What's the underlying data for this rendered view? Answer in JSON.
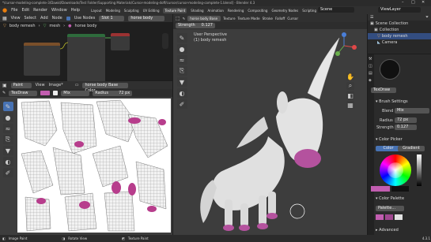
{
  "window": {
    "title": "*/cursor-modeling-complete-3/Dawid/Downloads/Test Folder/Supporting Materials/Cursor-modeling-doff/cursor/cursor-modeling-complete-1.blend] - Blender 4.3"
  },
  "menubar": {
    "items": [
      "File",
      "Edit",
      "Render",
      "Window",
      "Help"
    ],
    "workspaces": [
      "Layout",
      "Modeling",
      "Sculpting",
      "UV Editing",
      "Texture Paint",
      "Shading",
      "Animation",
      "Rendering",
      "Compositing",
      "Geometry Nodes",
      "Scripting"
    ],
    "active_workspace": "Texture Paint",
    "scene": "Scene",
    "view_layer": "ViewLayer"
  },
  "node_editor": {
    "header": [
      "View",
      "Select",
      "Add",
      "Node"
    ],
    "use_nodes_label": "Use Nodes",
    "slot": "Slot 1",
    "material": "horse body",
    "breadcrumb": [
      "body remesh",
      "mesh",
      "horse body"
    ]
  },
  "image_editor": {
    "header": [
      "Paint",
      "View",
      "Image*"
    ],
    "image_name": "horse body Base Color",
    "brush": "TexDraw",
    "blend": "Mix",
    "radius_label": "Radius",
    "radius": "72 px"
  },
  "viewport": {
    "header_items": [
      "Texture",
      "Texture Mode",
      "Stroke",
      "Falloff",
      "Cursor"
    ],
    "strength_label": "Strength",
    "strength": "0.127",
    "brush_name": "horse body Base ...",
    "view_name": "User Perspective",
    "object_name": "(1) body remesh"
  },
  "outliner": {
    "title": "Scene Collection",
    "items": [
      "Collection",
      "body remesh",
      "Camera"
    ]
  },
  "properties": {
    "brush_name": "TexDraw",
    "brush_settings_title": "Brush Settings",
    "blend_label": "Blend",
    "blend": "Mix",
    "radius_label": "Radius",
    "radius": "72 px",
    "strength_label": "Strength",
    "strength": "0.127",
    "color_picker_title": "Color Picker",
    "color_tab": "Color",
    "gradient_tab": "Gradient",
    "color_palette_title": "Color Palette",
    "palette_name": "Palette...",
    "advanced_title": "Advanced",
    "accent_color": "#c25db0"
  },
  "statusbar": {
    "items": [
      "Image Paint",
      "Rotate View",
      "Texture Paint"
    ],
    "version": "4.3.1"
  }
}
